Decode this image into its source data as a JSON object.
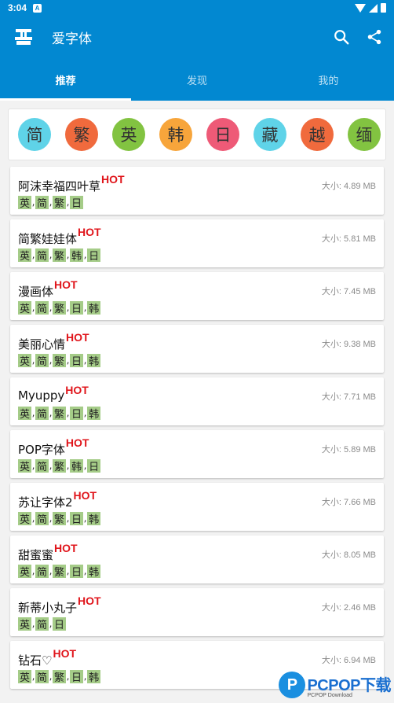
{
  "status_bar": {
    "time": "3:04",
    "notif_letter": "A"
  },
  "app_bar": {
    "title": "爱字体"
  },
  "tabs": [
    {
      "label": "推荐",
      "active": true
    },
    {
      "label": "发现",
      "active": false
    },
    {
      "label": "我的",
      "active": false
    }
  ],
  "languages": [
    {
      "label": "简",
      "color": "#5fd3e8"
    },
    {
      "label": "繁",
      "color": "#f06a3d"
    },
    {
      "label": "英",
      "color": "#82c341"
    },
    {
      "label": "韩",
      "color": "#f7a53b"
    },
    {
      "label": "日",
      "color": "#ee5a77"
    },
    {
      "label": "藏",
      "color": "#5fd3e8"
    },
    {
      "label": "越",
      "color": "#f06a3d"
    },
    {
      "label": "缅",
      "color": "#82c341"
    }
  ],
  "fonts": [
    {
      "name": "阿沫幸福四叶草",
      "hot": "HOT",
      "size": "大小: 4.89 MB",
      "tags": [
        "英",
        "简",
        "繁",
        "日"
      ]
    },
    {
      "name": "简繁娃娃体",
      "hot": "HOT",
      "size": "大小: 5.81 MB",
      "tags": [
        "英",
        "简",
        "繁",
        "韩",
        "日"
      ]
    },
    {
      "name": "漫画体",
      "hot": "HOT",
      "size": "大小: 7.45 MB",
      "tags": [
        "英",
        "简",
        "繁",
        "日",
        "韩"
      ]
    },
    {
      "name": "美丽心情",
      "hot": "HOT",
      "size": "大小: 9.38 MB",
      "tags": [
        "英",
        "简",
        "繁",
        "日",
        "韩"
      ]
    },
    {
      "name": "Myuppy",
      "hot": "HOT",
      "size": "大小: 7.71 MB",
      "tags": [
        "英",
        "简",
        "繁",
        "日",
        "韩"
      ]
    },
    {
      "name": "POP字体",
      "hot": "HOT",
      "size": "大小: 5.89 MB",
      "tags": [
        "英",
        "简",
        "繁",
        "韩",
        "日"
      ]
    },
    {
      "name": "苏让字体2",
      "hot": "HOT",
      "size": "大小: 7.66 MB",
      "tags": [
        "英",
        "简",
        "繁",
        "日",
        "韩"
      ]
    },
    {
      "name": "甜蜜蜜",
      "hot": "HOT",
      "size": "大小: 8.05 MB",
      "tags": [
        "英",
        "简",
        "繁",
        "日",
        "韩"
      ]
    },
    {
      "name": "新蒂小丸子",
      "hot": "HOT",
      "size": "大小: 2.46 MB",
      "tags": [
        "英",
        "简",
        "日"
      ]
    },
    {
      "name": "钻石♡",
      "hot": "HOT",
      "size": "大小: 6.94 MB",
      "tags": [
        "英",
        "简",
        "繁",
        "日",
        "韩"
      ]
    }
  ],
  "tag_separator": ",",
  "watermark": {
    "logo_letter": "P",
    "text": "PCPOP下载",
    "sub": "PCPOP Download"
  },
  "colors": {
    "primary": "#0288d1",
    "hot": "#e0151b",
    "tag_bg": "#a5cc88"
  }
}
